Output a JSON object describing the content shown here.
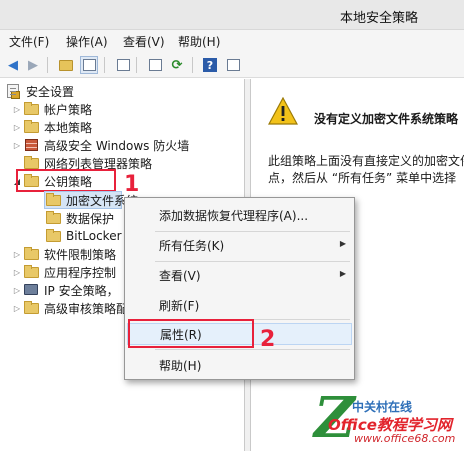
{
  "window": {
    "title": "本地安全策略"
  },
  "menubar": {
    "items": [
      "文件(F)",
      "操作(A)",
      "查看(V)",
      "帮助(H)"
    ]
  },
  "toolbar": {
    "help_glyph": "?"
  },
  "tree": {
    "items": [
      {
        "label": "安全设置"
      },
      {
        "label": "帐户策略"
      },
      {
        "label": "本地策略"
      },
      {
        "label": "高级安全 Windows 防火墙"
      },
      {
        "label": "网络列表管理器策略"
      },
      {
        "label": "公钥策略"
      },
      {
        "label": "加密文件系统"
      },
      {
        "label": "数据保护"
      },
      {
        "label": "BitLocker"
      },
      {
        "label": "软件限制策略"
      },
      {
        "label": "应用程序控制"
      },
      {
        "label": "IP 安全策略，"
      },
      {
        "label": "高级审核策略配"
      }
    ]
  },
  "annotations": {
    "step1": "1",
    "step2": "2"
  },
  "details": {
    "heading": "没有定义加密文件系统策略",
    "line1": "此组策略上面没有直接定义的加密文件",
    "line2": "点，然后从 “所有任务” 菜单中选择"
  },
  "context_menu": {
    "items": [
      {
        "label": "添加数据恢复代理程序(A)..."
      },
      {
        "label": "所有任务(K)"
      },
      {
        "label": "查看(V)"
      },
      {
        "label": "刷新(F)"
      },
      {
        "label": "属性(R)"
      },
      {
        "label": "帮助(H)"
      }
    ]
  },
  "watermark": {
    "mark": "Z",
    "top": "中关村在线",
    "middle": "Office教程学习网",
    "url": "www.office68.com"
  },
  "colors": {
    "annotation_red": "#e8213b",
    "selection_blue": "#d5e4f5",
    "folder_yellow": "#e8c867",
    "warning_yellow": "#f2c21a"
  }
}
